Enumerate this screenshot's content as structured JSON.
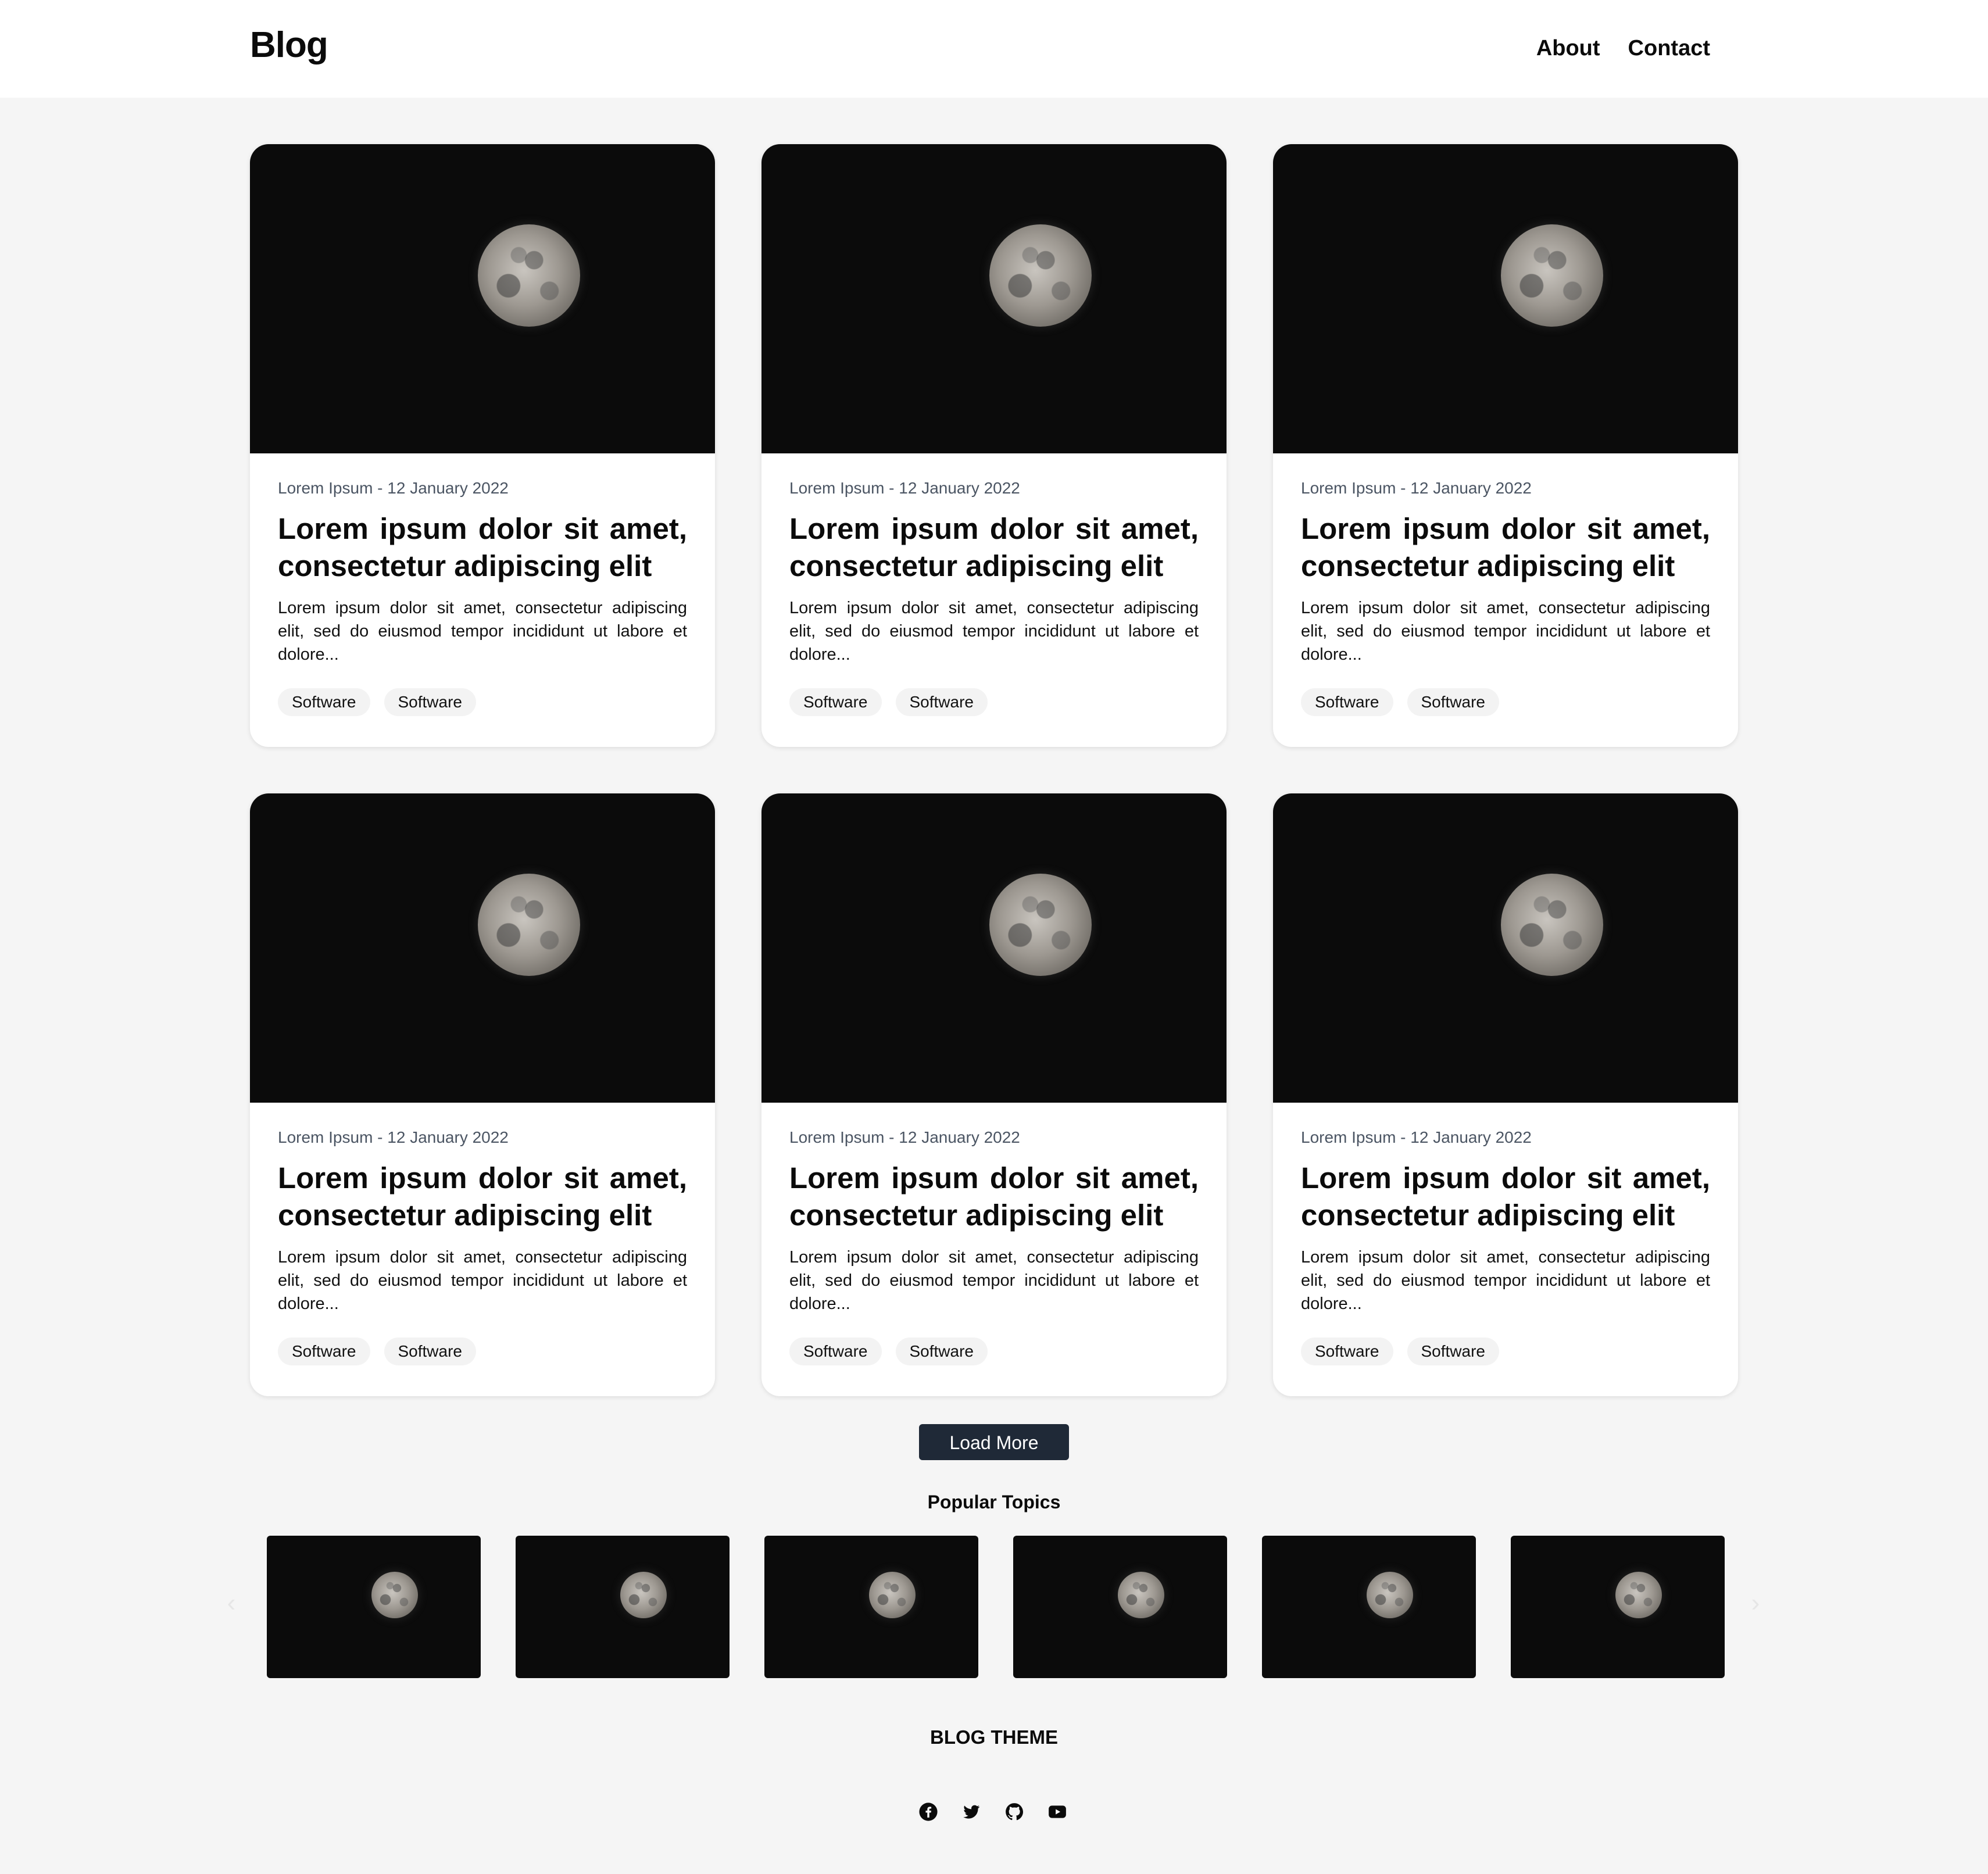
{
  "header": {
    "brand": "Blog",
    "nav": [
      "About",
      "Contact"
    ]
  },
  "cards": [
    {
      "meta": "Lorem Ipsum - 12 January 2022",
      "title": "Lorem ipsum dolor sit amet, consectetur adipiscing elit",
      "excerpt": "Lorem ipsum dolor sit amet, consectetur adipiscing elit, sed do eiusmod tempor incididunt ut labore et dolore...",
      "tags": [
        "Software",
        "Software"
      ]
    },
    {
      "meta": "Lorem Ipsum - 12 January 2022",
      "title": "Lorem ipsum dolor sit amet, consectetur adipiscing elit",
      "excerpt": "Lorem ipsum dolor sit amet, consectetur adipiscing elit, sed do eiusmod tempor incididunt ut labore et dolore...",
      "tags": [
        "Software",
        "Software"
      ]
    },
    {
      "meta": "Lorem Ipsum - 12 January 2022",
      "title": "Lorem ipsum dolor sit amet, consectetur adipiscing elit",
      "excerpt": "Lorem ipsum dolor sit amet, consectetur adipiscing elit, sed do eiusmod tempor incididunt ut labore et dolore...",
      "tags": [
        "Software",
        "Software"
      ]
    },
    {
      "meta": "Lorem Ipsum - 12 January 2022",
      "title": "Lorem ipsum dolor sit amet, consectetur adipiscing elit",
      "excerpt": "Lorem ipsum dolor sit amet, consectetur adipiscing elit, sed do eiusmod tempor incididunt ut labore et dolore...",
      "tags": [
        "Software",
        "Software"
      ]
    },
    {
      "meta": "Lorem Ipsum - 12 January 2022",
      "title": "Lorem ipsum dolor sit amet, consectetur adipiscing elit",
      "excerpt": "Lorem ipsum dolor sit amet, consectetur adipiscing elit, sed do eiusmod tempor incididunt ut labore et dolore...",
      "tags": [
        "Software",
        "Software"
      ]
    },
    {
      "meta": "Lorem Ipsum - 12 January 2022",
      "title": "Lorem ipsum dolor sit amet, consectetur adipiscing elit",
      "excerpt": "Lorem ipsum dolor sit amet, consectetur adipiscing elit, sed do eiusmod tempor incididunt ut labore et dolore...",
      "tags": [
        "Software",
        "Software"
      ]
    }
  ],
  "load_more": "Load More",
  "popular_topics": {
    "title": "Popular Topics",
    "count": 6
  },
  "footer": {
    "title": "BLOG THEME",
    "socials": [
      "facebook-icon",
      "twitter-icon",
      "github-icon",
      "youtube-icon"
    ]
  },
  "colors": {
    "page_bg": "#f5f5f5",
    "button_bg": "#1f2937",
    "tag_bg": "#f3f3f3"
  }
}
